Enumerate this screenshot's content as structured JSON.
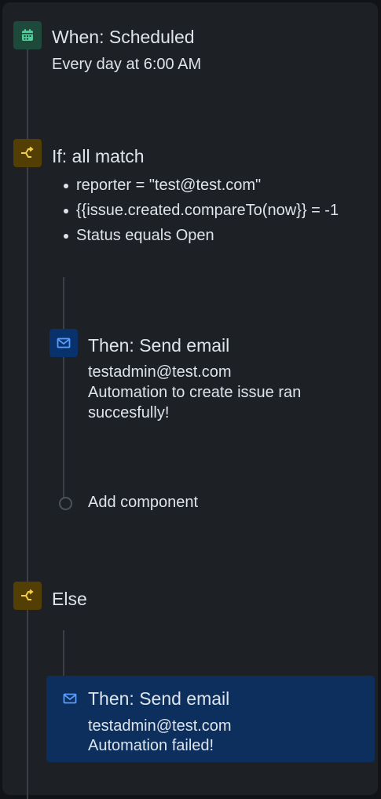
{
  "trigger": {
    "title": "When: Scheduled",
    "subtitle": "Every day at 6:00 AM",
    "icon": "calendar-icon",
    "icon_color": "#4bce97"
  },
  "condition": {
    "title": "If: all match",
    "icon": "branch-icon",
    "icon_color": "#f5cd47",
    "items": [
      "reporter = \"test@test.com\"",
      "{{issue.created.compareTo(now}} = -1",
      "Status equals Open"
    ]
  },
  "then_action": {
    "title": "Then: Send email",
    "recipient": "testadmin@test.com",
    "message": "Automation to create issue ran succesfully!",
    "icon": "mail-icon",
    "icon_color": "#579dff"
  },
  "add_component": {
    "label": "Add component"
  },
  "else_block": {
    "title": "Else",
    "icon": "branch-icon"
  },
  "else_action": {
    "title": "Then: Send email",
    "recipient": "testadmin@test.com",
    "message": "Automation failed!",
    "icon": "mail-icon",
    "selected": true,
    "selected_color": "#0c2f5e"
  }
}
